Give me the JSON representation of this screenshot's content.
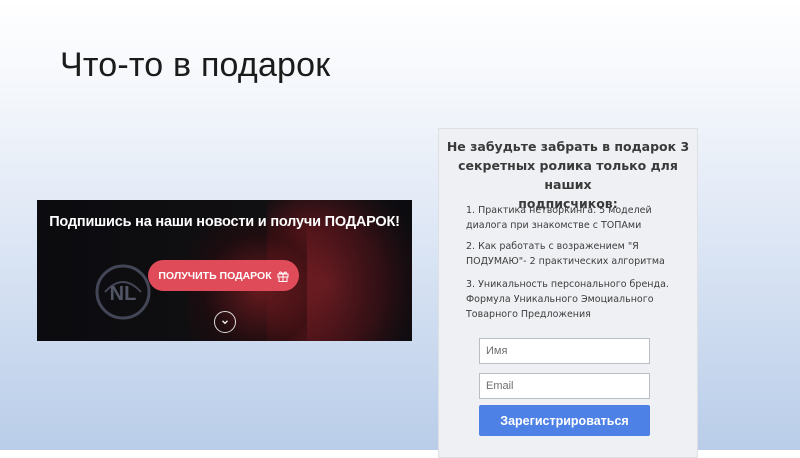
{
  "slide": {
    "title": "Что-то в подарок"
  },
  "banner": {
    "heading": "Подпишись на наши новости и получи ПОДАРОК!",
    "button_label": "ПОЛУЧИТЬ ПОДАРОК",
    "button_icon": "gift-icon",
    "scroll_icon": "chevron-down-icon",
    "logo_text": "NL"
  },
  "form": {
    "heading_lines": [
      "Не забудьте забрать в подарок 3",
      "секретных ролика только для наших",
      "подписчиков:"
    ],
    "items": [
      {
        "line1": "1. Практика нетворкинга. 5 моделей",
        "line2": "диалога при знакомстве с ТОПАми",
        "line3": ""
      },
      {
        "line1": "2. Как работать с возражением \"Я",
        "line2": "ПОДУМАЮ\"- 2 практических алгоритма",
        "line3": ""
      },
      {
        "line1": "3. Уникальность персонального бренда.",
        "line2": "Формула Уникального Эмоциального",
        "line3": "Товарного Предложения"
      }
    ],
    "name_placeholder": "Имя",
    "email_placeholder": "Email",
    "submit_label": "Зарегистрироваться"
  },
  "colors": {
    "gift_button": "#e04b5a",
    "submit_button": "#4e81e6"
  }
}
